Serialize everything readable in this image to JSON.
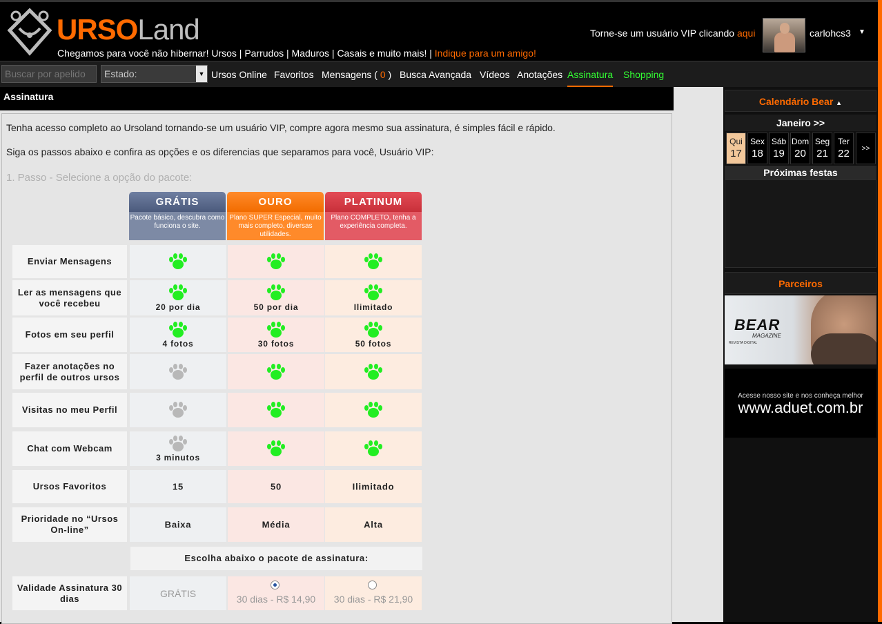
{
  "header": {
    "brand_a": "URSO",
    "brand_b": "Land",
    "slogan": "Chegamos para você não hibernar! Ursos | Parrudos | Maduros | Casais e muito mais! |",
    "slogan_link": "Indique para um amigo!",
    "vip_text": "Torne-se um usuário VIP clicando",
    "vip_link": "aqui",
    "username": "carlohcs3",
    "user_caret": "▼"
  },
  "nav": {
    "search_placeholder": "Buscar por apelido",
    "state_label": "Estado:",
    "state_arrow": "▼",
    "items": {
      "ursos_online": "Ursos Online",
      "favoritos": "Favoritos",
      "mensagens": "Mensagens (",
      "mensagens_count": "0",
      "mensagens_close": ")",
      "busca": "Busca Avançada",
      "videos": "Vídeos",
      "anotacoes": "Anotações",
      "assinatura": "Assinatura",
      "shopping": "Shopping"
    }
  },
  "main": {
    "title": "Assinatura",
    "intro1": "Tenha acesso completo ao Ursoland tornando-se um usuário VIP, compre agora mesmo sua assinatura, é simples fácil e rápido.",
    "intro2": "Siga os passos abaixo e confira as opções e os diferencias que separamos para você, Usuário VIP:",
    "step": "1. Passo - Selecione a opção do pacote:",
    "plans": [
      {
        "name": "GRÁTIS",
        "desc": "Pacote básico, descubra como funciona o site."
      },
      {
        "name": "OURO",
        "desc": "Plano SUPER Especial, muito mais completo, diversas utilidades."
      },
      {
        "name": "PLATINUM",
        "desc": "Plano COMPLETO, tenha a experiência completa."
      }
    ],
    "features": [
      {
        "label": "Enviar Mensagens",
        "gratis": "",
        "ouro": "",
        "plat": ""
      },
      {
        "label": "Ler as mensagens que você recebeu",
        "gratis": "20 por dia",
        "ouro": "50 por dia",
        "plat": "Ilimitado"
      },
      {
        "label": "Fotos em seu perfil",
        "gratis": "4 fotos",
        "ouro": "30 fotos",
        "plat": "50 fotos"
      },
      {
        "label": "Fazer anotações no perfil de outros ursos",
        "gratis": "",
        "ouro": "",
        "plat": ""
      },
      {
        "label": "Visitas no meu Perfil",
        "gratis": "",
        "ouro": "",
        "plat": ""
      },
      {
        "label": "Chat com Webcam",
        "gratis": "3 minutos",
        "ouro": "",
        "plat": ""
      },
      {
        "label": "Ursos Favoritos",
        "gratis": "15",
        "ouro": "50",
        "plat": "Ilimitado"
      },
      {
        "label": "Prioridade no “Ursos On-line”",
        "gratis": "Baixa",
        "ouro": "Média",
        "plat": "Alta"
      }
    ],
    "choose": "Escolha abaixo o pacote de assinatura:",
    "validity_label": "Validade Assinatura 30 dias",
    "opt_gratis": "GRÁTIS",
    "opt_ouro": "30 dias - R$ 14,90",
    "opt_plat": "30 dias - R$ 21,90",
    "paw_colors": {
      "active": "#22ee22",
      "inactive": "#b8b8b8"
    }
  },
  "sidebar": {
    "calendar_title": "Calendário Bear",
    "calendar_caret": "▲",
    "month": "Janeiro >>",
    "days": [
      {
        "name": "Qui",
        "num": "17"
      },
      {
        "name": "Sex",
        "num": "18"
      },
      {
        "name": "Sáb",
        "num": "19"
      },
      {
        "name": "Dom",
        "num": "20"
      },
      {
        "name": "Seg",
        "num": "21"
      },
      {
        "name": "Ter",
        "num": "22"
      }
    ],
    "next": ">>",
    "parties_title": "Próximas festas",
    "partners_title": "Parceiros",
    "ad_bear_logo": "BEAR",
    "ad_bear_sub": "MAGAZINE",
    "ad_bear_tag": "REVISTA DIGITAL",
    "ad_aduet_t1": "Acesse nosso site e nos conheça melhor",
    "ad_aduet_t2": "www.aduet.com.br"
  }
}
